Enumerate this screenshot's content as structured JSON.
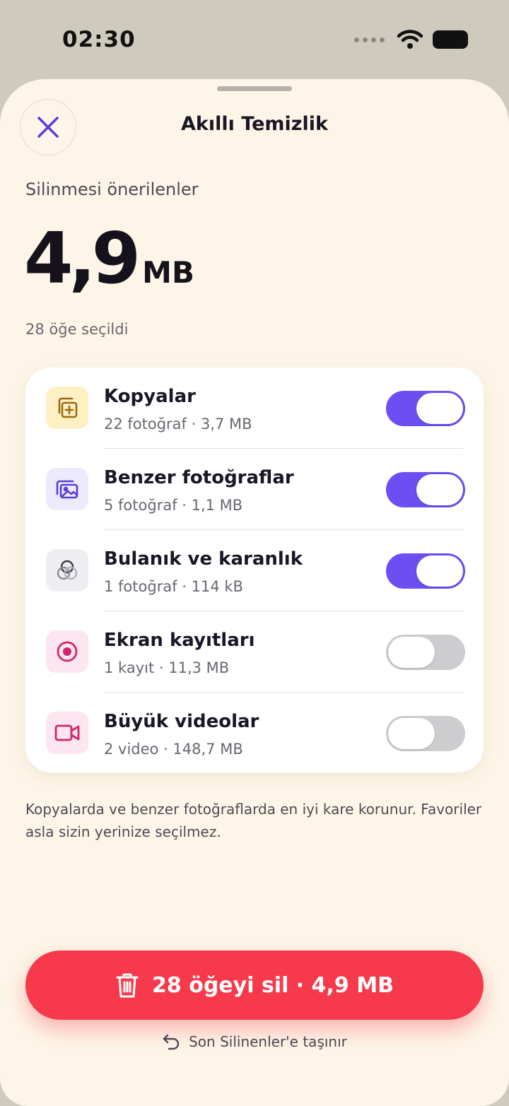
{
  "status": {
    "time": "02:30"
  },
  "sheet": {
    "title": "Akıllı Temizlik",
    "subtitle": "Silinmesi önerilenler",
    "size_value": "4,9",
    "size_unit": "MB",
    "selected_count": "28 öğe seçildi"
  },
  "categories": [
    {
      "title": "Kopyalar",
      "subtitle": "22 fotoğraf · 3,7 MB",
      "enabled": true,
      "icon": "duplicate-icon",
      "icon_bg": "#fdf0c2",
      "icon_color": "#9a6a10"
    },
    {
      "title": "Benzer fotoğraflar",
      "subtitle": "5 fotoğraf · 1,1 MB",
      "enabled": true,
      "icon": "photos-icon",
      "icon_bg": "#eeeafd",
      "icon_color": "#5b3fd6"
    },
    {
      "title": "Bulanık ve karanlık",
      "subtitle": "1 fotoğraf · 114 kB",
      "enabled": true,
      "icon": "blur-icon",
      "icon_bg": "#eeeef2",
      "icon_color": "#3d3a44"
    },
    {
      "title": "Ekran kayıtları",
      "subtitle": "1 kayıt · 11,3 MB",
      "enabled": false,
      "icon": "record-icon",
      "icon_bg": "#fde6ef",
      "icon_color": "#d4246c"
    },
    {
      "title": "Büyük videolar",
      "subtitle": "2 video · 148,7 MB",
      "enabled": false,
      "icon": "video-icon",
      "icon_bg": "#fde6ef",
      "icon_color": "#d4246c"
    }
  ],
  "footnote": "Kopyalarda ve benzer fotoğraflarda en iyi kare korunur. Favoriler asla sizin yerinize seçilmez.",
  "delete_button": {
    "label": "28 öğeyi sil · 4,9 MB"
  },
  "move_note": "Son Silinenler'e taşınır",
  "colors": {
    "accent": "#6c4ef2",
    "danger": "#f6394b",
    "sheet_bg": "#fdf6e8"
  }
}
